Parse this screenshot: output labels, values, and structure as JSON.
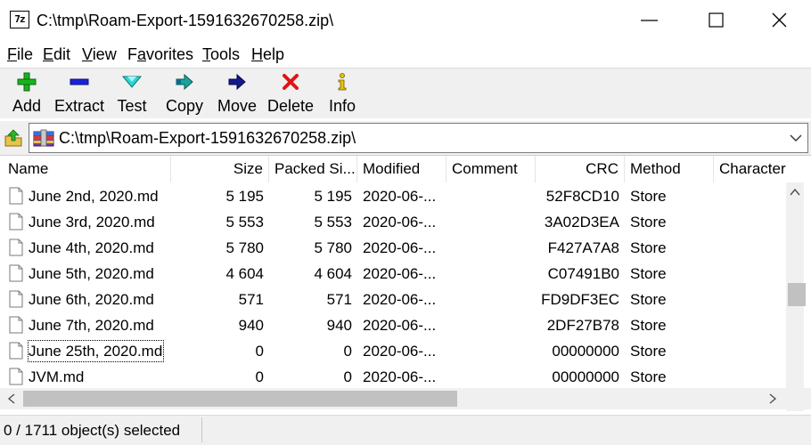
{
  "window": {
    "title": "C:\\tmp\\Roam-Export-1591632670258.zip\\",
    "icon_text": "7z"
  },
  "menu": [
    {
      "key": "F",
      "rest": "ile"
    },
    {
      "key": "E",
      "rest": "dit"
    },
    {
      "key": "V",
      "rest": "iew"
    },
    {
      "key": "",
      "pre": "F",
      "key2": "a",
      "rest": "vorites"
    },
    {
      "key": "T",
      "rest": "ools"
    },
    {
      "key": "H",
      "rest": "elp"
    }
  ],
  "toolbar": {
    "add": "Add",
    "extract": "Extract",
    "test": "Test",
    "copy": "Copy",
    "move": "Move",
    "delete": "Delete",
    "info": "Info"
  },
  "address": {
    "path": "C:\\tmp\\Roam-Export-1591632670258.zip\\"
  },
  "columns": [
    "Name",
    "Size",
    "Packed Si...",
    "Modified",
    "Comment",
    "CRC",
    "Method",
    "Character"
  ],
  "rows": [
    {
      "name": "June 2nd, 2020.md",
      "size": "5 195",
      "packed": "5 195",
      "modified": "2020-06-...",
      "comment": "",
      "crc": "52F8CD10",
      "method": "Store"
    },
    {
      "name": "June 3rd, 2020.md",
      "size": "5 553",
      "packed": "5 553",
      "modified": "2020-06-...",
      "comment": "",
      "crc": "3A02D3EA",
      "method": "Store"
    },
    {
      "name": "June 4th, 2020.md",
      "size": "5 780",
      "packed": "5 780",
      "modified": "2020-06-...",
      "comment": "",
      "crc": "F427A7A8",
      "method": "Store"
    },
    {
      "name": "June 5th, 2020.md",
      "size": "4 604",
      "packed": "4 604",
      "modified": "2020-06-...",
      "comment": "",
      "crc": "C07491B0",
      "method": "Store"
    },
    {
      "name": "June 6th, 2020.md",
      "size": "571",
      "packed": "571",
      "modified": "2020-06-...",
      "comment": "",
      "crc": "FD9DF3EC",
      "method": "Store"
    },
    {
      "name": "June 7th, 2020.md",
      "size": "940",
      "packed": "940",
      "modified": "2020-06-...",
      "comment": "",
      "crc": "2DF27B78",
      "method": "Store"
    },
    {
      "name": "June 25th, 2020.md",
      "size": "0",
      "packed": "0",
      "modified": "2020-06-...",
      "comment": "",
      "crc": "00000000",
      "method": "Store",
      "focused": true
    },
    {
      "name": "JVM.md",
      "size": "0",
      "packed": "0",
      "modified": "2020-06-...",
      "comment": "",
      "crc": "00000000",
      "method": "Store"
    }
  ],
  "status": {
    "text": "0 / 1711 object(s) selected"
  }
}
